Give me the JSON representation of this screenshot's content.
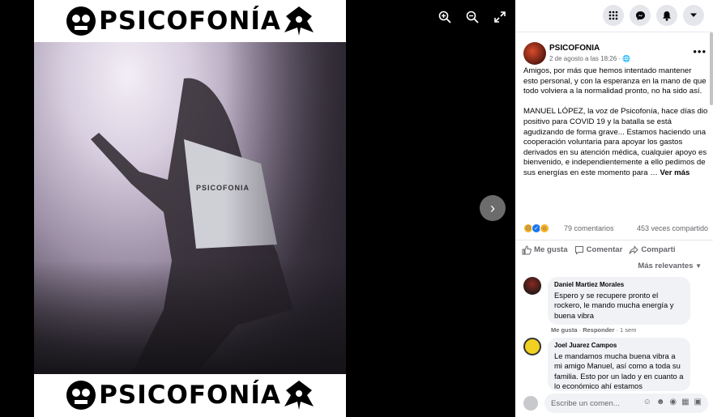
{
  "photo": {
    "banner_text": "PSICOFONÍA",
    "shirt_text": "PSICOFONIA"
  },
  "viewer_controls": {
    "zoom_in_icon": "zoom-in-icon",
    "zoom_out_icon": "zoom-out-icon",
    "fullscreen_icon": "fullscreen-icon",
    "next_icon": "chevron-right-icon"
  },
  "topbar": {
    "icons": [
      "grid-menu-icon",
      "messenger-icon",
      "bell-icon",
      "caret-down-icon"
    ]
  },
  "post": {
    "author": "PSICOFONIA",
    "date": "2 de agosto a las 18:26 ·",
    "paragraph1": "Amigos, por más que hemos intentado mantener esto personal, y con la esperanza en la mano de que todo volviera a la normalidad pronto, no ha sido así.",
    "paragraph2": "MANUEL LÓPEZ, la voz de Psicofonía, hace días dio positivo para COVID 19 y la batalla se está agudizando de forma grave... Estamos haciendo una cooperación voluntaria para apoyar los gastos derivados en su atención médica, cualquier apoyo es bienvenido, e independientemente a ello pedimos de sus energías en este momento para …",
    "see_more": "Ver más",
    "comments_count": "79 comentarios",
    "shares_count": "453 veces compartido"
  },
  "actions": {
    "like": "Me gusta",
    "comment": "Comentar",
    "share": "Comparti"
  },
  "sort_label": "Más relevantes",
  "comments": [
    {
      "name": "Daniel Martiez Morales",
      "text": "Espero y se recupere pronto el rockero, le mando mucha energía y buena vibra",
      "like": "Me gusta",
      "reply": "Responder",
      "time": "1 sem"
    },
    {
      "name": "Joel Juarez Campos",
      "text": "Le mandamos mucha buena vibra a mi amigo Manuel, así como a toda su familia. Esto por un lado y en cuanto a lo económico ahí estamos"
    }
  ],
  "comment_box": {
    "placeholder": "Escribe un comen..."
  }
}
